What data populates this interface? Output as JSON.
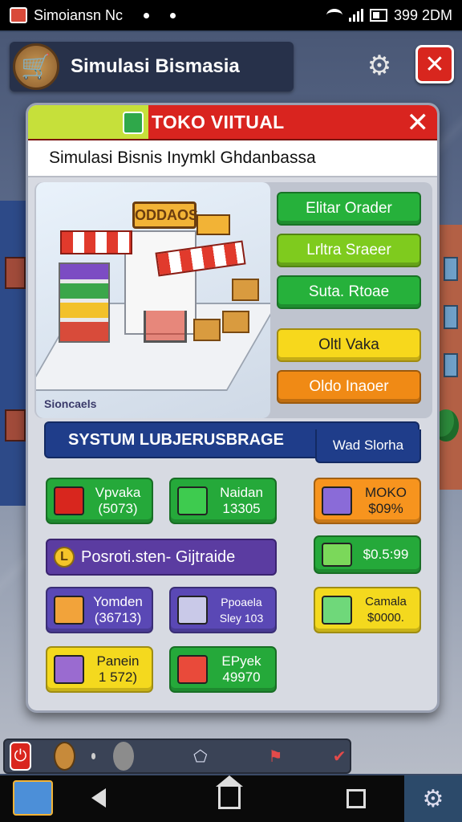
{
  "status_bar": {
    "app_name": "Simoiansn Nc",
    "time": "399 2DM"
  },
  "header": {
    "title": "Simulasi Bismasia",
    "logo_icon": "shopping-cart-icon",
    "settings_icon": "gear-icon",
    "close_icon": "close-x-icon"
  },
  "modal": {
    "title": "TOKO VIITUAL",
    "close_glyph": "✕",
    "subtitle": "Simulasi Bisnis Inymkl Ghdanbassa",
    "scene": {
      "sign_text": "ODDAOS",
      "label": "Sioncaels"
    },
    "side_buttons": [
      {
        "label": "Elitar Orader",
        "color": "#26b13b"
      },
      {
        "label": "Lrltra Sraeer",
        "color": "#7fcb1e"
      },
      {
        "label": "Suta. Rtoae",
        "color": "#26b13b"
      },
      {
        "label": "Oltl Vaka",
        "color": "#f7d81c"
      },
      {
        "label": "Oldo Inaoer",
        "color": "#f08a15"
      }
    ],
    "system_banner": {
      "title": "SYSTUM LUBJERUSBRAGE",
      "subtitle": "Wad Slorha"
    },
    "stats": {
      "vpvaka": {
        "label": "Vpvaka",
        "value": "(5073)"
      },
      "naidan": {
        "label": "Naidan",
        "value": "13305"
      },
      "moko": {
        "label": "MOKO",
        "value": "$09%"
      },
      "money": {
        "value": "$0.5:99"
      },
      "yomden": {
        "label": "Yomden",
        "value": "(36713)"
      },
      "ppoaela": {
        "label": "Ppoaela",
        "value": "Sley 103"
      },
      "camala": {
        "label": "Camala",
        "value": "$0000."
      },
      "panein": {
        "label": "Panein",
        "value": "1 572)"
      },
      "epyek": {
        "label": "EPyek",
        "value": "49970"
      }
    },
    "partner": {
      "label": "Posroti.sten- Gijtraide",
      "coin_glyph": "L"
    }
  }
}
